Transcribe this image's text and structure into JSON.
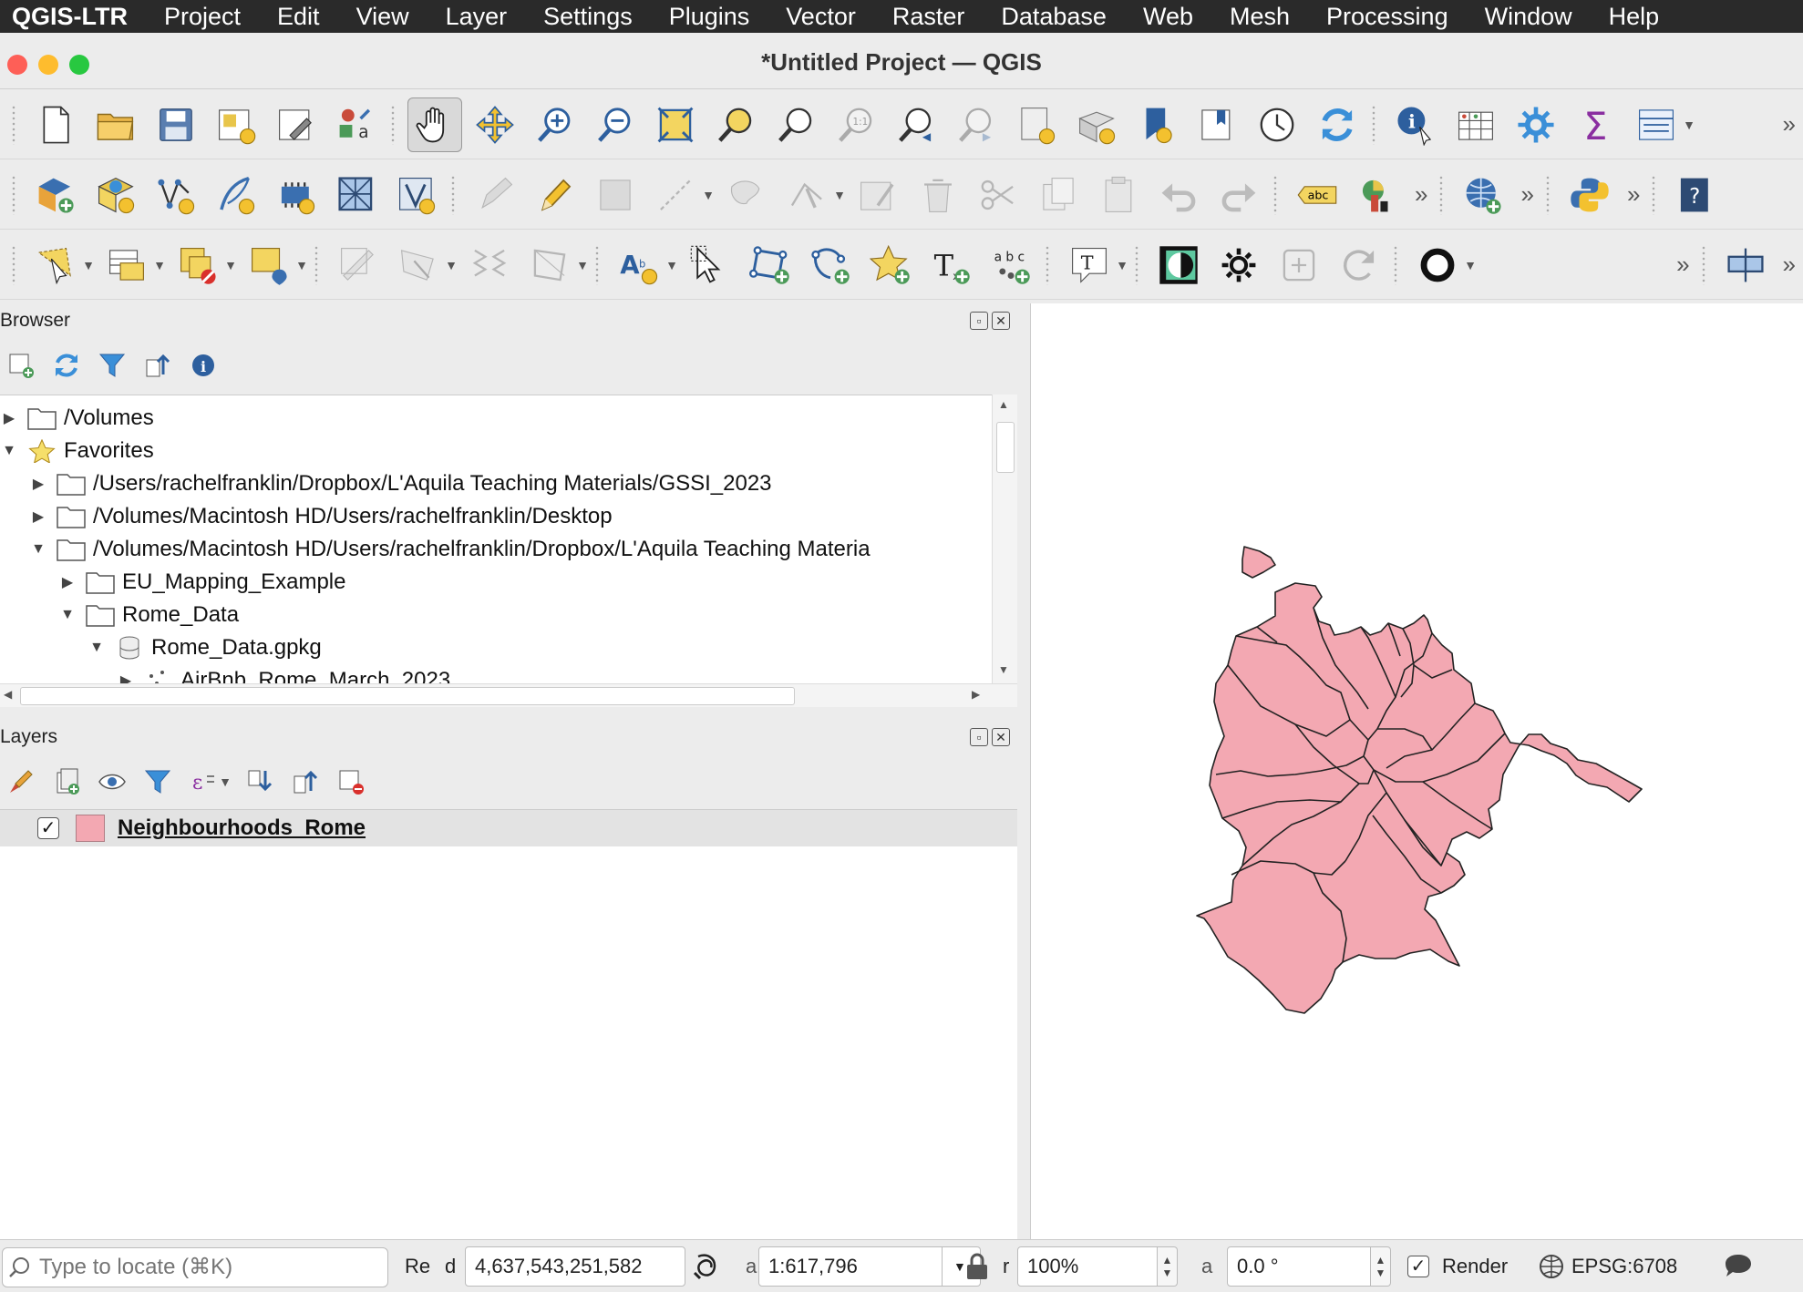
{
  "menubar": {
    "app": "QGIS-LTR",
    "items": [
      "Project",
      "Edit",
      "View",
      "Layer",
      "Settings",
      "Plugins",
      "Vector",
      "Raster",
      "Database",
      "Web",
      "Mesh",
      "Processing",
      "Window",
      "Help"
    ]
  },
  "window": {
    "title": "*Untitled Project — QGIS"
  },
  "toolbars": {
    "row1_icons": [
      "new-project-icon",
      "open-project-icon",
      "save-project-icon",
      "new-print-layout-icon",
      "layout-manager-icon",
      "style-manager-icon",
      "pan-map-icon",
      "pan-to-selection-icon",
      "zoom-in-icon",
      "zoom-out-icon",
      "zoom-full-icon",
      "zoom-to-selection-icon",
      "zoom-to-layer-icon",
      "zoom-native-resolution-icon",
      "zoom-last-icon",
      "zoom-next-icon",
      "new-map-view-icon",
      "new-3d-map-view-icon",
      "new-bookmark-icon",
      "show-bookmarks-icon",
      "temporal-controller-icon",
      "refresh-icon",
      "identify-features-icon",
      "open-attribute-table-icon",
      "toolbox-icon",
      "statistical-summary-icon",
      "open-field-calculator-icon"
    ],
    "row2_icons": [
      "data-source-manager-icon",
      "new-geopackage-layer-icon",
      "new-shapefile-layer-icon",
      "new-spatialite-layer-icon",
      "new-memory-layer-icon",
      "new-mesh-layer-icon",
      "new-virtual-layer-icon",
      "current-edits-icon",
      "toggle-editing-icon",
      "save-edits-icon",
      "digitize-icon",
      "add-polygon-icon",
      "vertex-tool-icon",
      "modify-attributes-icon",
      "delete-selected-icon",
      "cut-features-icon",
      "copy-features-icon",
      "paste-features-icon",
      "undo-icon",
      "redo-icon",
      "label-toolbar-icon",
      "diagram-icon",
      "georeferencer-icon",
      "python-console-icon",
      "help-icon"
    ],
    "row3_icons": [
      "select-features-icon",
      "select-by-value-icon",
      "deselect-icon",
      "select-location-icon",
      "rotate-feature-icon",
      "simplify-icon",
      "split-features-icon",
      "reshape-icon",
      "label-pin-icon",
      "select-tool-icon",
      "polygon-add-icon",
      "polygon-node-icon",
      "star-shape-icon",
      "text-annotation-icon",
      "abc-label-icon",
      "text-tool-icon",
      "contrast-icon",
      "settings-gear-icon",
      "add-frame-icon",
      "refresh-rotate-icon",
      "circle-tool-icon",
      "window-float-icon"
    ]
  },
  "browser": {
    "title": "Browser",
    "items": [
      {
        "label": "/Volumes",
        "level": 0,
        "expanded": false,
        "icon": "folder-icon"
      },
      {
        "label": "Favorites",
        "level": 0,
        "expanded": true,
        "icon": "star-icon"
      },
      {
        "label": "/Users/rachelfranklin/Dropbox/L'Aquila Teaching Materials/GSSI_2023",
        "level": 1,
        "expanded": false,
        "icon": "folder-icon"
      },
      {
        "label": "/Volumes/Macintosh HD/Users/rachelfranklin/Desktop",
        "level": 1,
        "expanded": false,
        "icon": "folder-icon"
      },
      {
        "label": "/Volumes/Macintosh HD/Users/rachelfranklin/Dropbox/L'Aquila Teaching Materia",
        "level": 1,
        "expanded": true,
        "icon": "folder-icon"
      },
      {
        "label": "EU_Mapping_Example",
        "level": 2,
        "expanded": false,
        "icon": "folder-icon"
      },
      {
        "label": "Rome_Data",
        "level": 2,
        "expanded": true,
        "icon": "folder-icon"
      },
      {
        "label": "Rome_Data.gpkg",
        "level": 3,
        "expanded": true,
        "icon": "database-icon"
      },
      {
        "label": "AirBnb_Rome_March_2023",
        "level": 4,
        "expanded": false,
        "icon": "point-layer-icon"
      }
    ]
  },
  "layers": {
    "title": "Layers",
    "items": [
      {
        "name": "Neighbourhoods_Rome",
        "checked": true,
        "color": "#f3a8b2"
      }
    ]
  },
  "statusbar": {
    "locator_placeholder": "Type to locate (⌘K)",
    "coord_label_a": "Re",
    "coord_label_b": "d",
    "coordinate": "4,637,543,251,582",
    "scale_label": "a",
    "scale": "1:617,796",
    "magnifier_label": "r",
    "magnifier": "100%",
    "rotation_label": "a",
    "rotation": "0.0 °",
    "render_label": "Render",
    "render_checked": true,
    "crs": "EPSG:6708"
  },
  "colors": {
    "polygon_fill": "#f3a8b2",
    "polygon_stroke": "#222222",
    "menubar": "#2a2a2a"
  }
}
